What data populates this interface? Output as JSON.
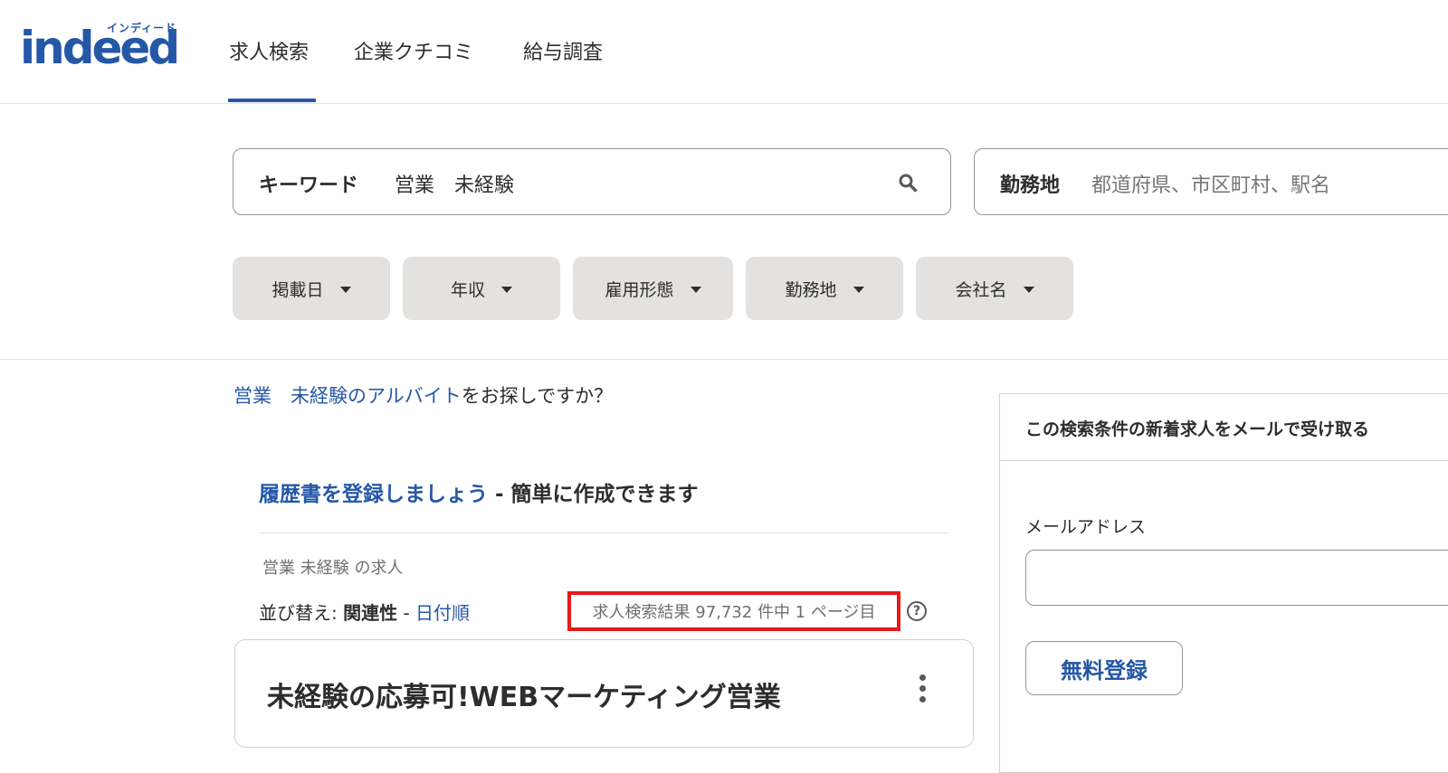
{
  "brand": {
    "logo_text": "indeed",
    "logo_kana": "インディード"
  },
  "nav": {
    "tabs": [
      {
        "label": "求人検索",
        "active": true
      },
      {
        "label": "企業クチコミ",
        "active": false
      },
      {
        "label": "給与調査",
        "active": false
      }
    ]
  },
  "search": {
    "keyword": {
      "label": "キーワード",
      "value": "営業　未経験",
      "icon": "search-icon"
    },
    "location": {
      "label": "勤務地",
      "placeholder": "都道府県、市区町村、駅名"
    }
  },
  "filters": [
    "掲載日",
    "年収",
    "雇用形態",
    "勤務地",
    "会社名"
  ],
  "suggestion": {
    "link": "営業　未経験のアルバイト",
    "rest": "をお探しですか？"
  },
  "resume": {
    "link": "履歴書を登録しましょう",
    "rest": " - 簡単に作成できます"
  },
  "results": {
    "query_heading": "営業 未経験 の求人",
    "sort_prefix": "並び替え: ",
    "sort_active": "関連性",
    "sort_sep": " - ",
    "sort_other": "日付順",
    "count_text": "求人検索結果 97,732 件中 1 ページ目",
    "help_symbol": "?"
  },
  "jobs": [
    {
      "title": "未経験の応募可!WEBマーケティング営業"
    }
  ],
  "alert": {
    "title": "この検索条件の新着求人をメールで受け取る",
    "email_label": "メールアドレス",
    "email_value": "",
    "button_label": "無料登録"
  },
  "colors": {
    "accent": "#2557a7",
    "highlight": "#e8191a",
    "filter_bg": "#e4e2e0"
  }
}
